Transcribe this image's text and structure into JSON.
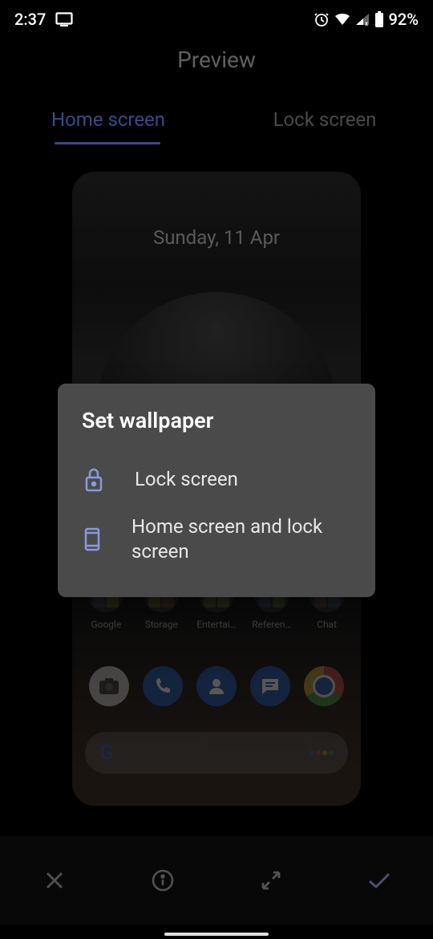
{
  "status": {
    "time": "2:37",
    "battery_pct": "92%"
  },
  "page": {
    "title": "Preview"
  },
  "tabs": {
    "home": "Home screen",
    "lock": "Lock screen"
  },
  "preview": {
    "date": "Sunday, 11 Apr",
    "folders": [
      {
        "label": "Google"
      },
      {
        "label": "Storage"
      },
      {
        "label": "Entertai…"
      },
      {
        "label": "Referen…"
      },
      {
        "label": "Chat"
      }
    ]
  },
  "dialog": {
    "title": "Set wallpaper",
    "option_lock": "Lock screen",
    "option_both": "Home screen and lock screen"
  }
}
